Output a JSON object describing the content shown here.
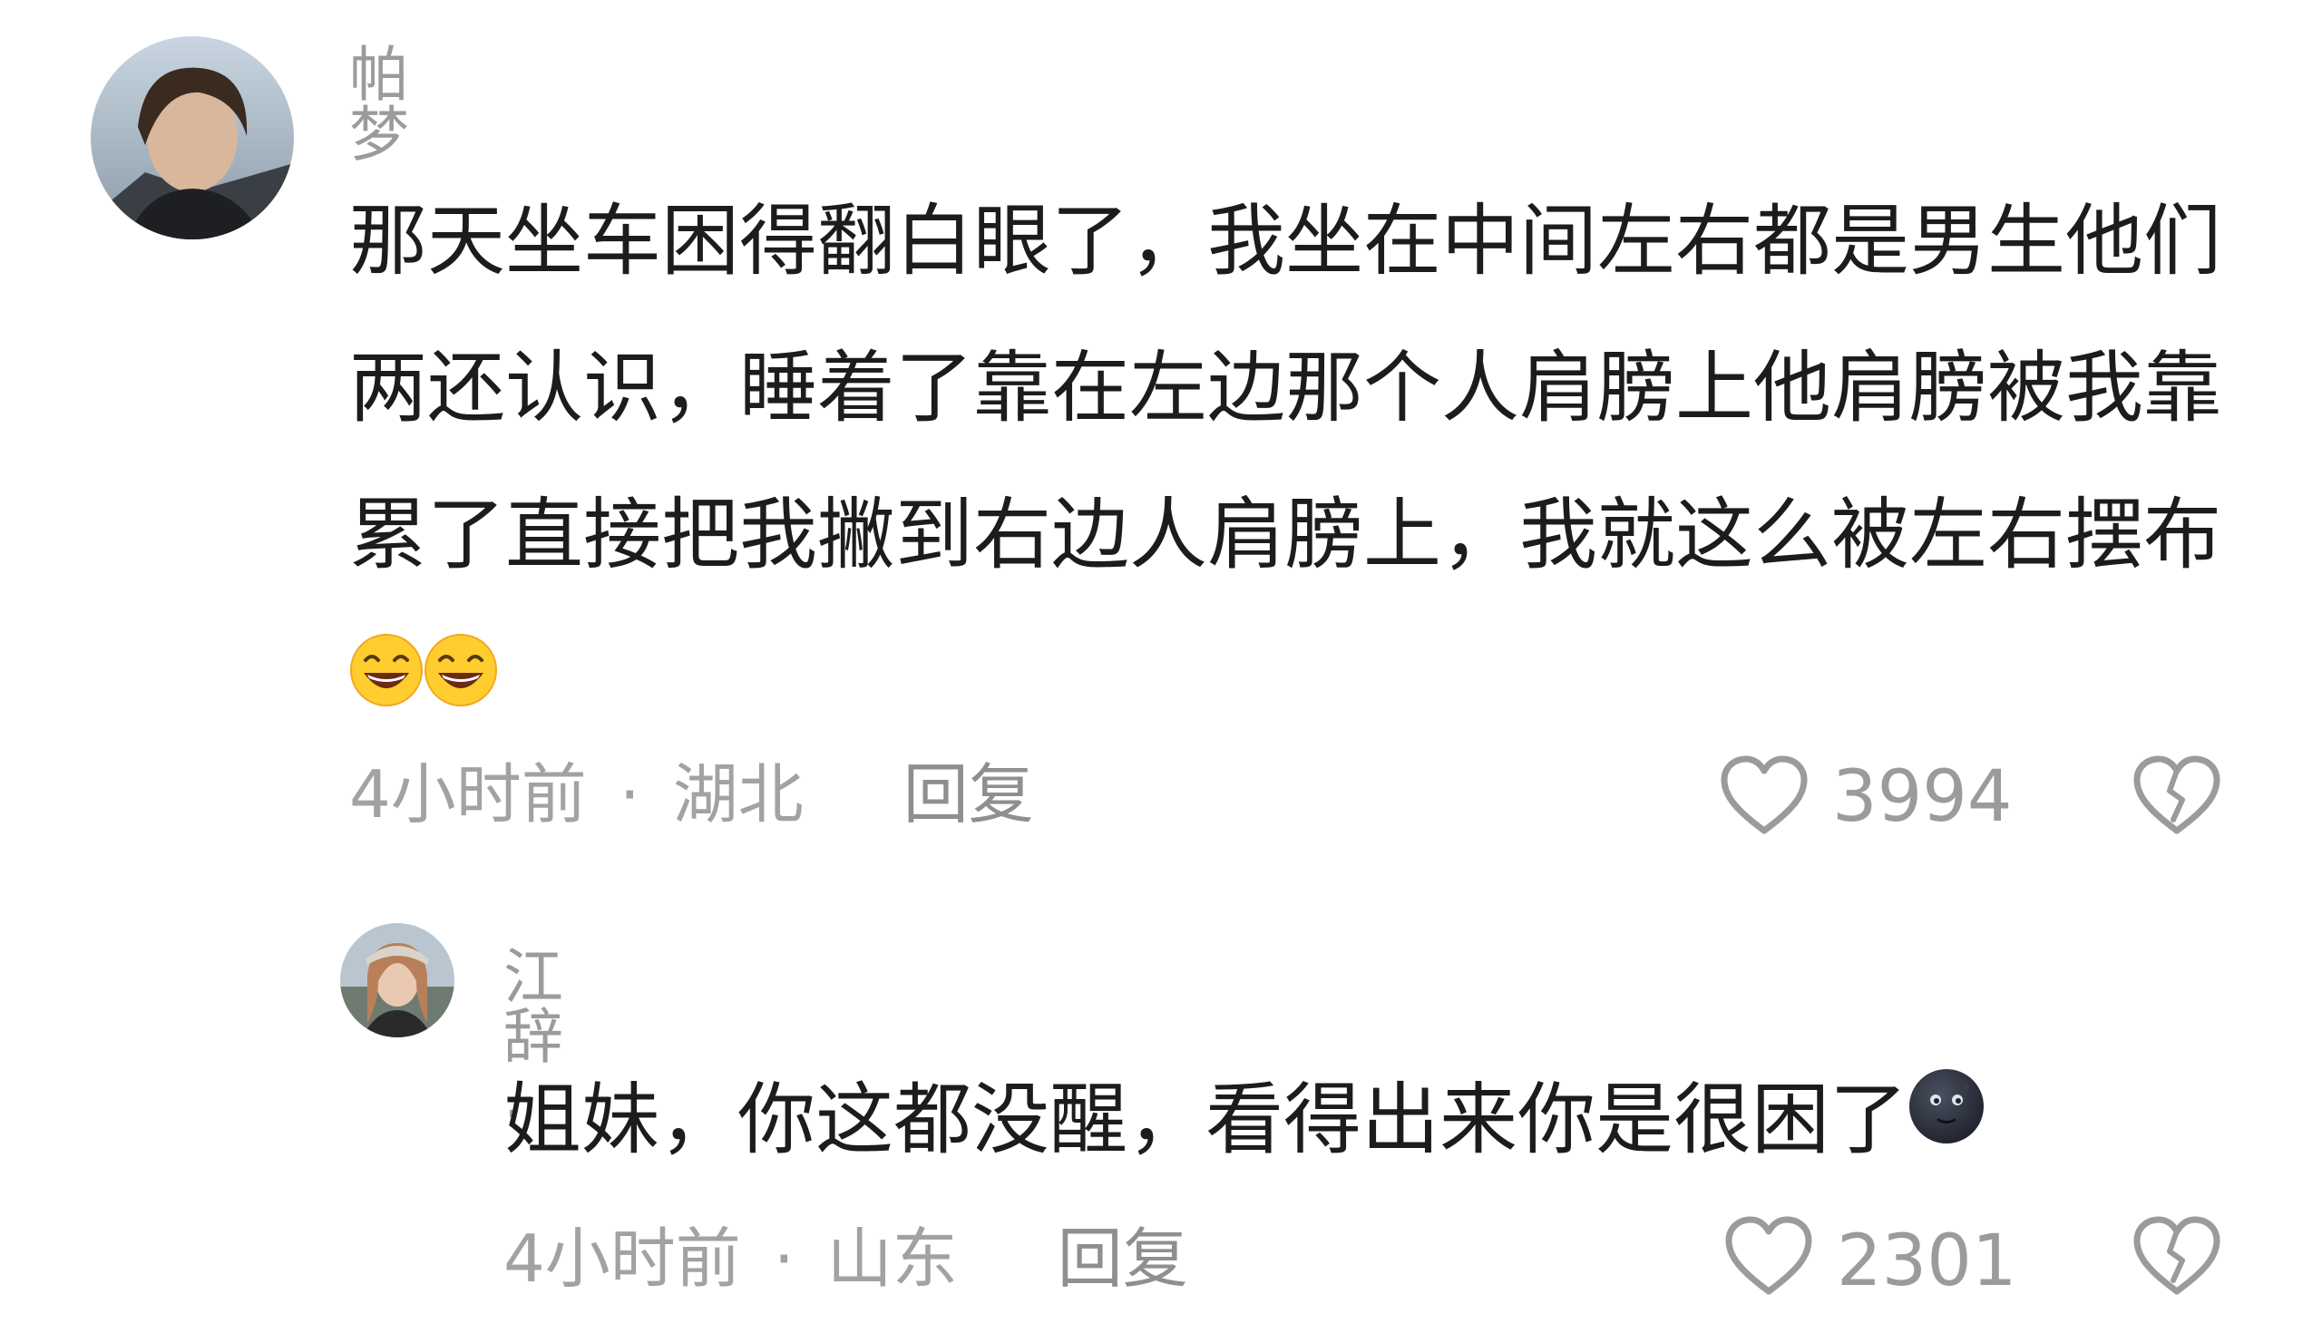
{
  "comments": [
    {
      "username": "帕梦",
      "avatar_icon": "user-avatar-photo",
      "text": "那天坐车困得翻白眼了，我坐在中间左右都是男生他们两还认识，睡着了靠在左边那个人肩膀上他肩膀被我靠累了直接把我撇到右边人肩膀上，我就这么被左右摆布",
      "emojis": [
        "grinning-squint-emoji",
        "grinning-squint-emoji"
      ],
      "time": "4小时前",
      "location": "湖北",
      "separator": "·",
      "reply_label": "回复",
      "like_count": "3994",
      "like_icon": "heart-outline-icon",
      "dislike_icon": "broken-heart-icon"
    },
    {
      "username": "江辞 .",
      "avatar_icon": "user-avatar-photo",
      "text": "姐妹，你这都没醒，看得出来你是很困了",
      "emojis": [
        "new-moon-face-emoji"
      ],
      "time": "4小时前",
      "location": "山东",
      "separator": "·",
      "reply_label": "回复",
      "like_count": "2301",
      "like_icon": "heart-outline-icon",
      "dislike_icon": "broken-heart-icon"
    }
  ],
  "colors": {
    "text_primary": "#1c1c1c",
    "text_secondary": "#9b9b9b",
    "emoji_yellow": "#ffcd2e",
    "emoji_dark": "#2c2f3a"
  }
}
